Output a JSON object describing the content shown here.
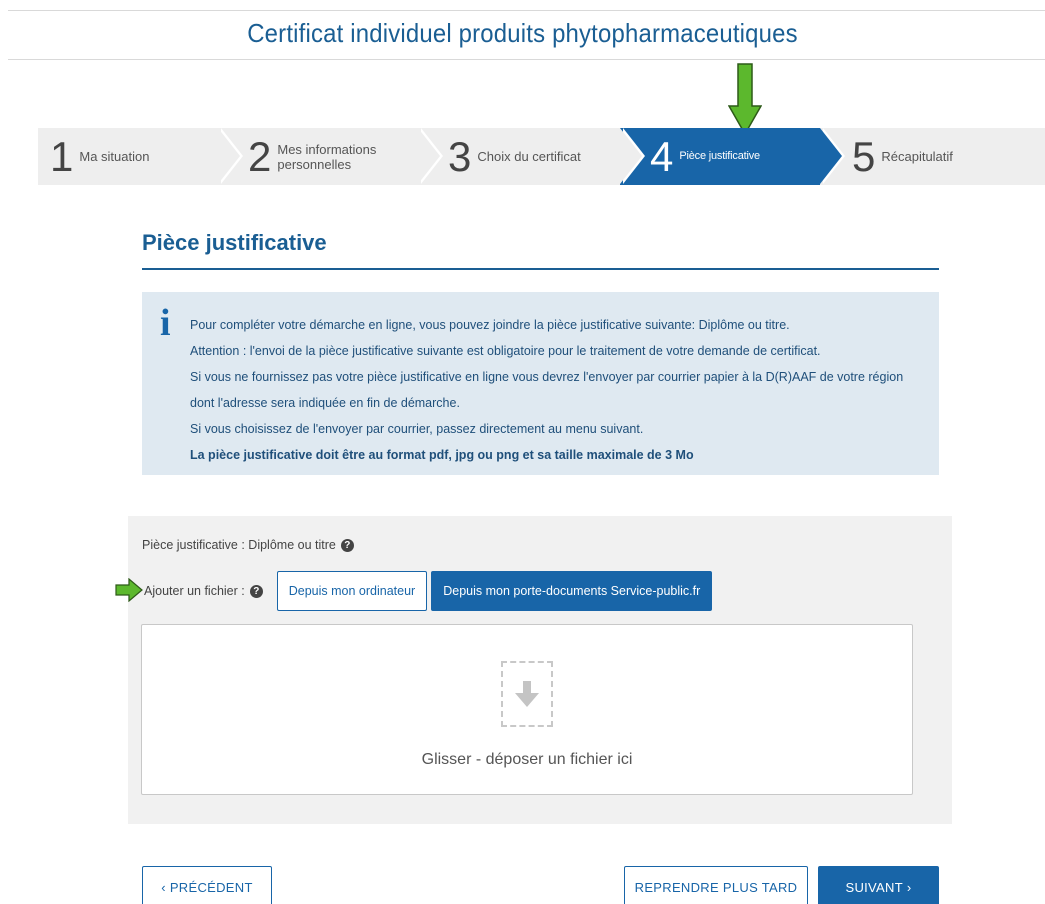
{
  "page": {
    "title": "Certificat individuel produits phytopharmaceutiques"
  },
  "stepper": {
    "steps": [
      {
        "num": "1",
        "label": "Ma situation"
      },
      {
        "num": "2",
        "label": "Mes informations personnelles"
      },
      {
        "num": "3",
        "label": "Choix du certificat"
      },
      {
        "num": "4",
        "label": "Pièce justificative"
      },
      {
        "num": "5",
        "label": "Récapitulatif"
      }
    ],
    "active_step": "4"
  },
  "section": {
    "title": "Pièce justificative"
  },
  "info": {
    "icon": "info-icon",
    "lines": [
      "Pour compléter votre démarche en ligne, vous pouvez joindre la pièce justificative suivante: Diplôme ou titre.",
      "Attention : l'envoi de la pièce justificative suivante est obligatoire pour le traitement de votre demande de certificat.",
      "Si vous ne fournissez pas votre pièce justificative en ligne vous devrez l'envoyer par courrier papier à la D(R)AAF de votre région dont l'adresse sera indiquée en fin de démarche.",
      "Si vous choisissez de l'envoyer par courrier, passez directement au menu suivant.",
      "La pièce justificative doit être au format pdf, jpg ou png et sa taille maximale de 3 Mo"
    ]
  },
  "upload": {
    "field_label": "Pièce justificative : Diplôme ou titre",
    "add_label": "Ajouter un fichier :",
    "btn_computer": "Depuis mon ordinateur",
    "btn_service_public": "Depuis mon porte-documents Service-public.fr",
    "dropzone_text": "Glisser - déposer un fichier ici"
  },
  "nav": {
    "prev": "PRÉCÉDENT",
    "later": "REPRENDRE PLUS TARD",
    "next": "SUIVANT"
  },
  "colors": {
    "primary": "#1865a8",
    "info_bg": "#dfe9f1",
    "annotation_green": "#5cb82d"
  }
}
